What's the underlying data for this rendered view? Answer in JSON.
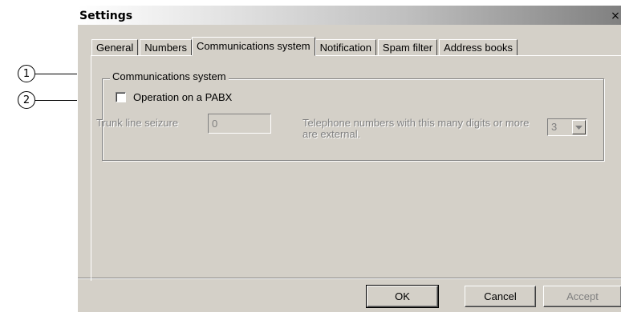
{
  "callouts": [
    {
      "number": "1"
    },
    {
      "number": "2"
    }
  ],
  "dialog": {
    "title": "Settings",
    "close_glyph": "×"
  },
  "tabs": [
    {
      "label": "General"
    },
    {
      "label": "Numbers"
    },
    {
      "label": "Communications system",
      "active": true
    },
    {
      "label": "Notification"
    },
    {
      "label": "Spam filter"
    },
    {
      "label": "Address books"
    }
  ],
  "communications": {
    "group_title": "Communications system",
    "pabx_label": "Operation on a PABX",
    "pabx_checked": false,
    "trunk_label": "Trunk line seizure",
    "trunk_value": "0",
    "tel_label_line1": "Telephone numbers with this many digits or more",
    "tel_label_line2": "are external.",
    "digits_value": "3"
  },
  "buttons": {
    "ok": "OK",
    "cancel": "Cancel",
    "accept": "Accept"
  },
  "colors": {
    "dialog_bg": "#d4d0c8",
    "disabled_text": "#808080"
  },
  "icons": {
    "dropdown": "chevron-down-icon",
    "close": "close-icon"
  }
}
